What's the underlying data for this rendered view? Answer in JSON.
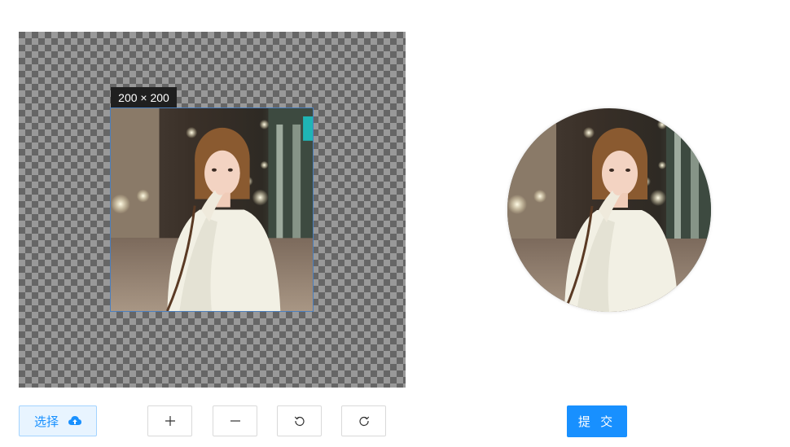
{
  "cropper": {
    "size_label": "200 × 200"
  },
  "controls": {
    "select_label": "选择",
    "submit_label": "提 交"
  },
  "icons": {
    "upload": "cloud-upload-icon",
    "zoom_in": "plus-icon",
    "zoom_out": "minus-icon",
    "rotate_left": "rotate-left-icon",
    "rotate_right": "rotate-right-icon"
  },
  "colors": {
    "primary": "#1890ff",
    "select_bg": "#e8f4ff",
    "crop_border": "#4a7fbf"
  }
}
